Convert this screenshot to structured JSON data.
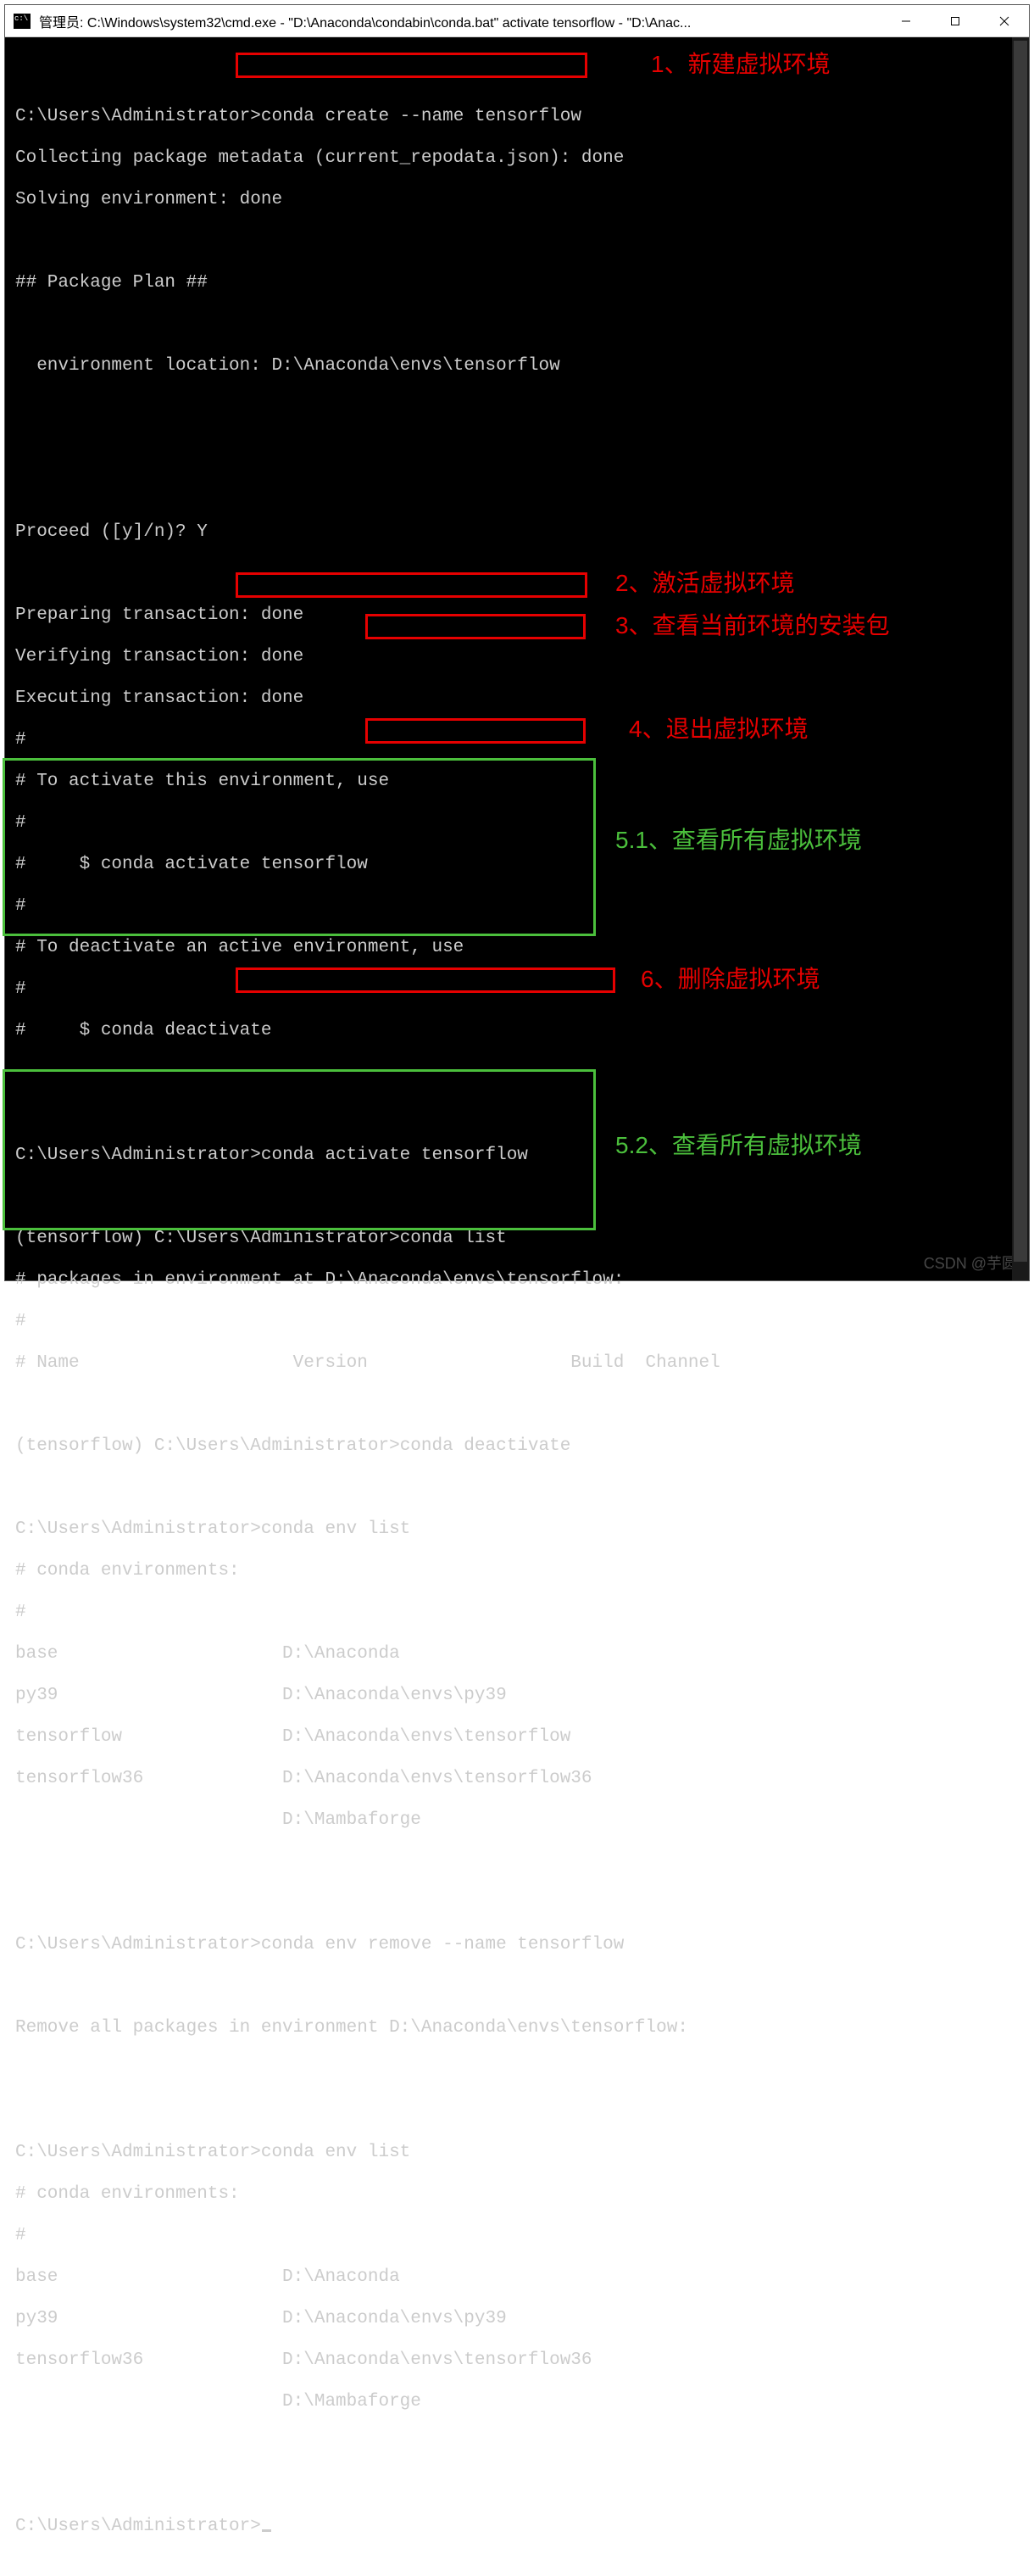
{
  "window": {
    "title": "管理员: C:\\Windows\\system32\\cmd.exe - \"D:\\Anaconda\\condabin\\conda.bat\"  activate tensorflow - \"D:\\Anac..."
  },
  "terminal": {
    "l00": "",
    "l01a": "C:\\Users\\Administrator>",
    "l01b": "conda create --name tensorflow",
    "l02": "Collecting package metadata (current_repodata.json): done",
    "l03": "Solving environment: done",
    "l04": "",
    "l05": "## Package Plan ##",
    "l06": "",
    "l07": "  environment location: D:\\Anaconda\\envs\\tensorflow",
    "l08": "",
    "l09": "",
    "l10": "",
    "l11": "Proceed ([y]/n)? Y",
    "l12": "",
    "l13": "Preparing transaction: done",
    "l14": "Verifying transaction: done",
    "l15": "Executing transaction: done",
    "l16": "#",
    "l17": "# To activate this environment, use",
    "l18": "#",
    "l19": "#     $ conda activate tensorflow",
    "l20": "#",
    "l21": "# To deactivate an active environment, use",
    "l22": "#",
    "l23": "#     $ conda deactivate",
    "l24": "",
    "l25": "",
    "l26a": "C:\\Users\\Administrator>",
    "l26b": "conda activate tensorflow",
    "l27": "",
    "l28a": "(tensorflow) C:\\Users\\Administrator>",
    "l28b": "conda list",
    "l29": "# packages in environment at D:\\Anaconda\\envs\\tensorflow:",
    "l30": "#",
    "l31": "# Name                    Version                   Build  Channel",
    "l32": "",
    "l33a": "(tensorflow) C:\\Users\\Administrator>",
    "l33b": "conda deactivate",
    "l34": "",
    "l35": "C:\\Users\\Administrator>conda env list",
    "l36": "# conda environments:",
    "l37": "#",
    "l38": "base                     D:\\Anaconda",
    "l39": "py39                     D:\\Anaconda\\envs\\py39",
    "l40": "tensorflow               D:\\Anaconda\\envs\\tensorflow",
    "l41": "tensorflow36             D:\\Anaconda\\envs\\tensorflow36",
    "l42": "                         D:\\Mambaforge",
    "l43": "",
    "l44": "",
    "l45a": "C:\\Users\\Administrator>",
    "l45b": "conda env remove --name tensorflow",
    "l46": "",
    "l47": "Remove all packages in environment D:\\Anaconda\\envs\\tensorflow:",
    "l48": "",
    "l49": "",
    "l50": "C:\\Users\\Administrator>conda env list",
    "l51": "# conda environments:",
    "l52": "#",
    "l53": "base                     D:\\Anaconda",
    "l54": "py39                     D:\\Anaconda\\envs\\py39",
    "l55": "tensorflow36             D:\\Anaconda\\envs\\tensorflow36",
    "l56": "                         D:\\Mambaforge",
    "l57": "",
    "l58": "",
    "l59": "C:\\Users\\Administrator>"
  },
  "annotations": {
    "a1": "1、新建虚拟环境",
    "a2": "2、激活虚拟环境",
    "a3": "3、查看当前环境的安装包",
    "a4": "4、退出虚拟环境",
    "a51": "5.1、查看所有虚拟环境",
    "a6": "6、删除虚拟环境",
    "a52": "5.2、查看所有虚拟环境"
  },
  "watermark": "CSDN @芋圆"
}
